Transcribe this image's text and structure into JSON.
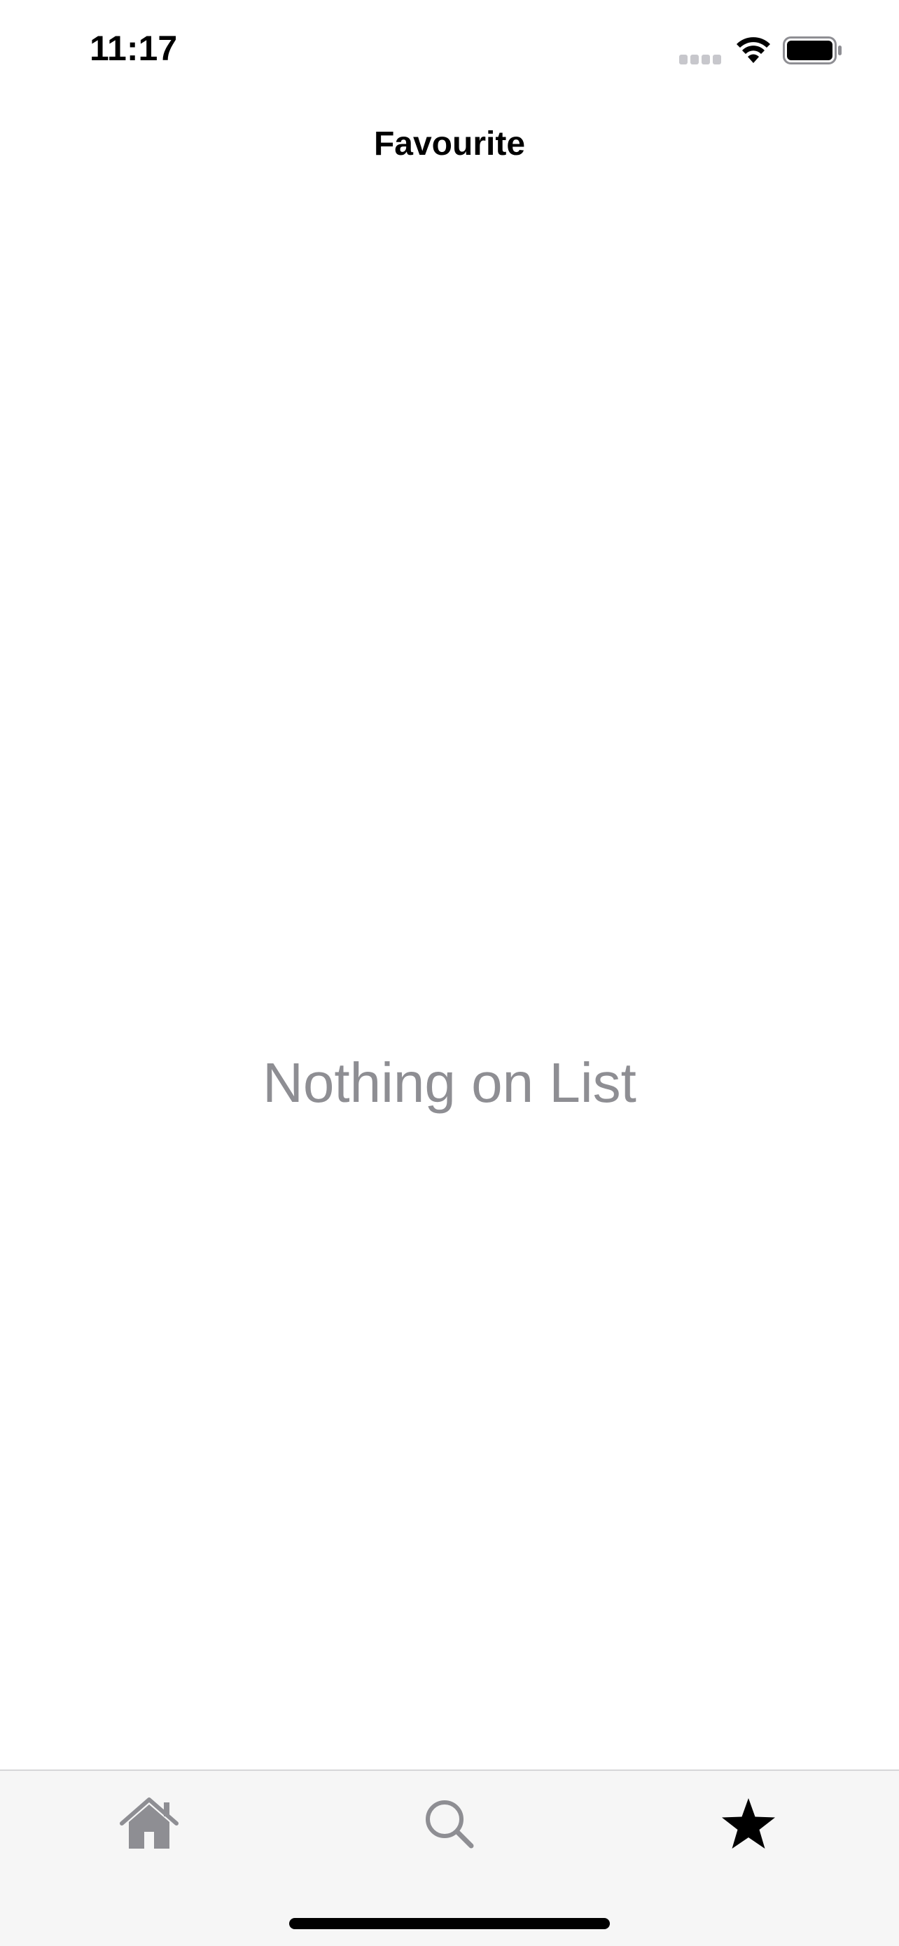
{
  "status_bar": {
    "time": "11:17",
    "icons": [
      "cellular-signal-icon",
      "wifi-icon",
      "battery-icon"
    ]
  },
  "nav": {
    "title": "Favourite"
  },
  "main": {
    "empty_message": "Nothing on List"
  },
  "tab_bar": {
    "tabs": [
      {
        "icon": "home-icon",
        "selected": false
      },
      {
        "icon": "search-icon",
        "selected": false
      },
      {
        "icon": "star-icon",
        "selected": true
      }
    ]
  },
  "colors": {
    "active_tab": "#000000",
    "inactive_tab": "#8e8e93",
    "empty_text": "#8e8e93",
    "tab_bar_background": "#f6f6f6"
  }
}
